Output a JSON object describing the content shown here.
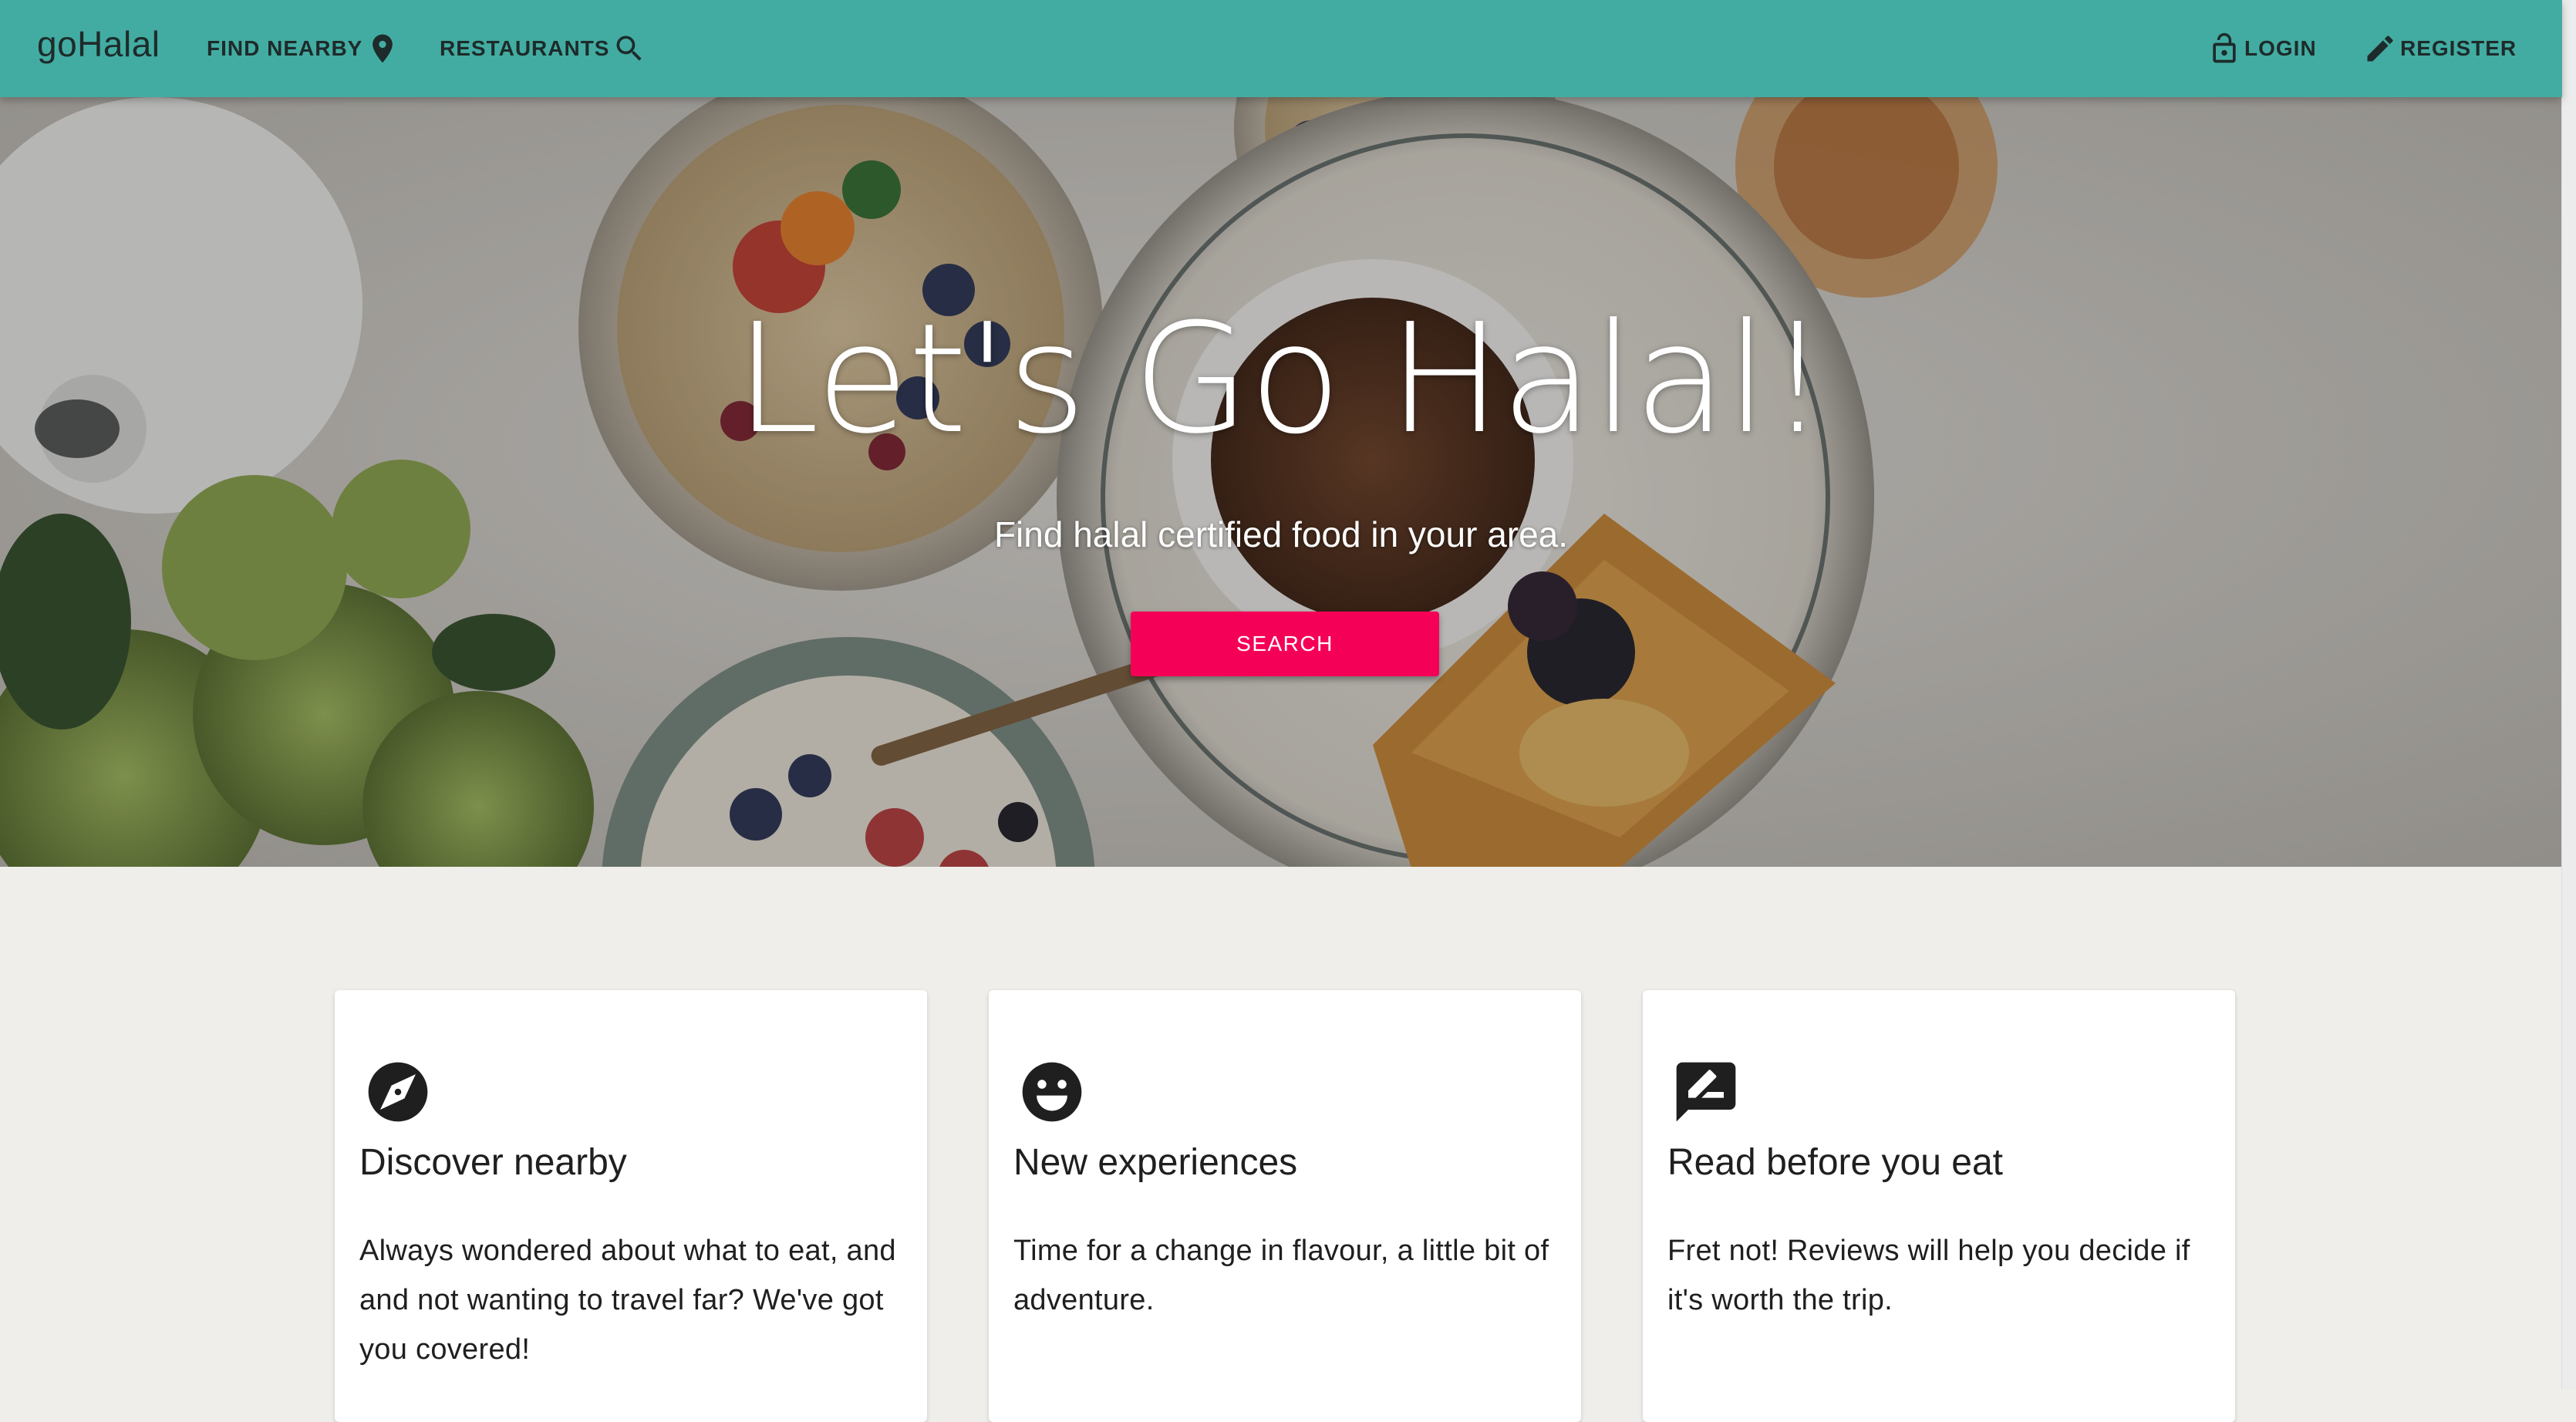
{
  "nav": {
    "brand": "goHalal",
    "find_nearby": "FIND NEARBY",
    "restaurants": "RESTAURANTS",
    "login": "LOGIN",
    "register": "REGISTER"
  },
  "hero": {
    "title": "Let's Go Halal!",
    "subtitle": "Find halal certified food in your area.",
    "search_button": "SEARCH"
  },
  "features": [
    {
      "icon": "compass-icon",
      "title": "Discover nearby",
      "text": "Always wondered about what to eat, and and not wanting to travel far? We've got you covered!"
    },
    {
      "icon": "smiley-face-icon",
      "title": "New experiences",
      "text": "Time for a change in flavour, a little bit of adventure."
    },
    {
      "icon": "review-comment-icon",
      "title": "Read before you eat",
      "text": "Fret not! Reviews will help you decide if it's worth the trip."
    }
  ],
  "colors": {
    "topbar": "#43aca2",
    "accent": "#f50057",
    "page_background": "#efeeea",
    "card_background": "#ffffff"
  }
}
